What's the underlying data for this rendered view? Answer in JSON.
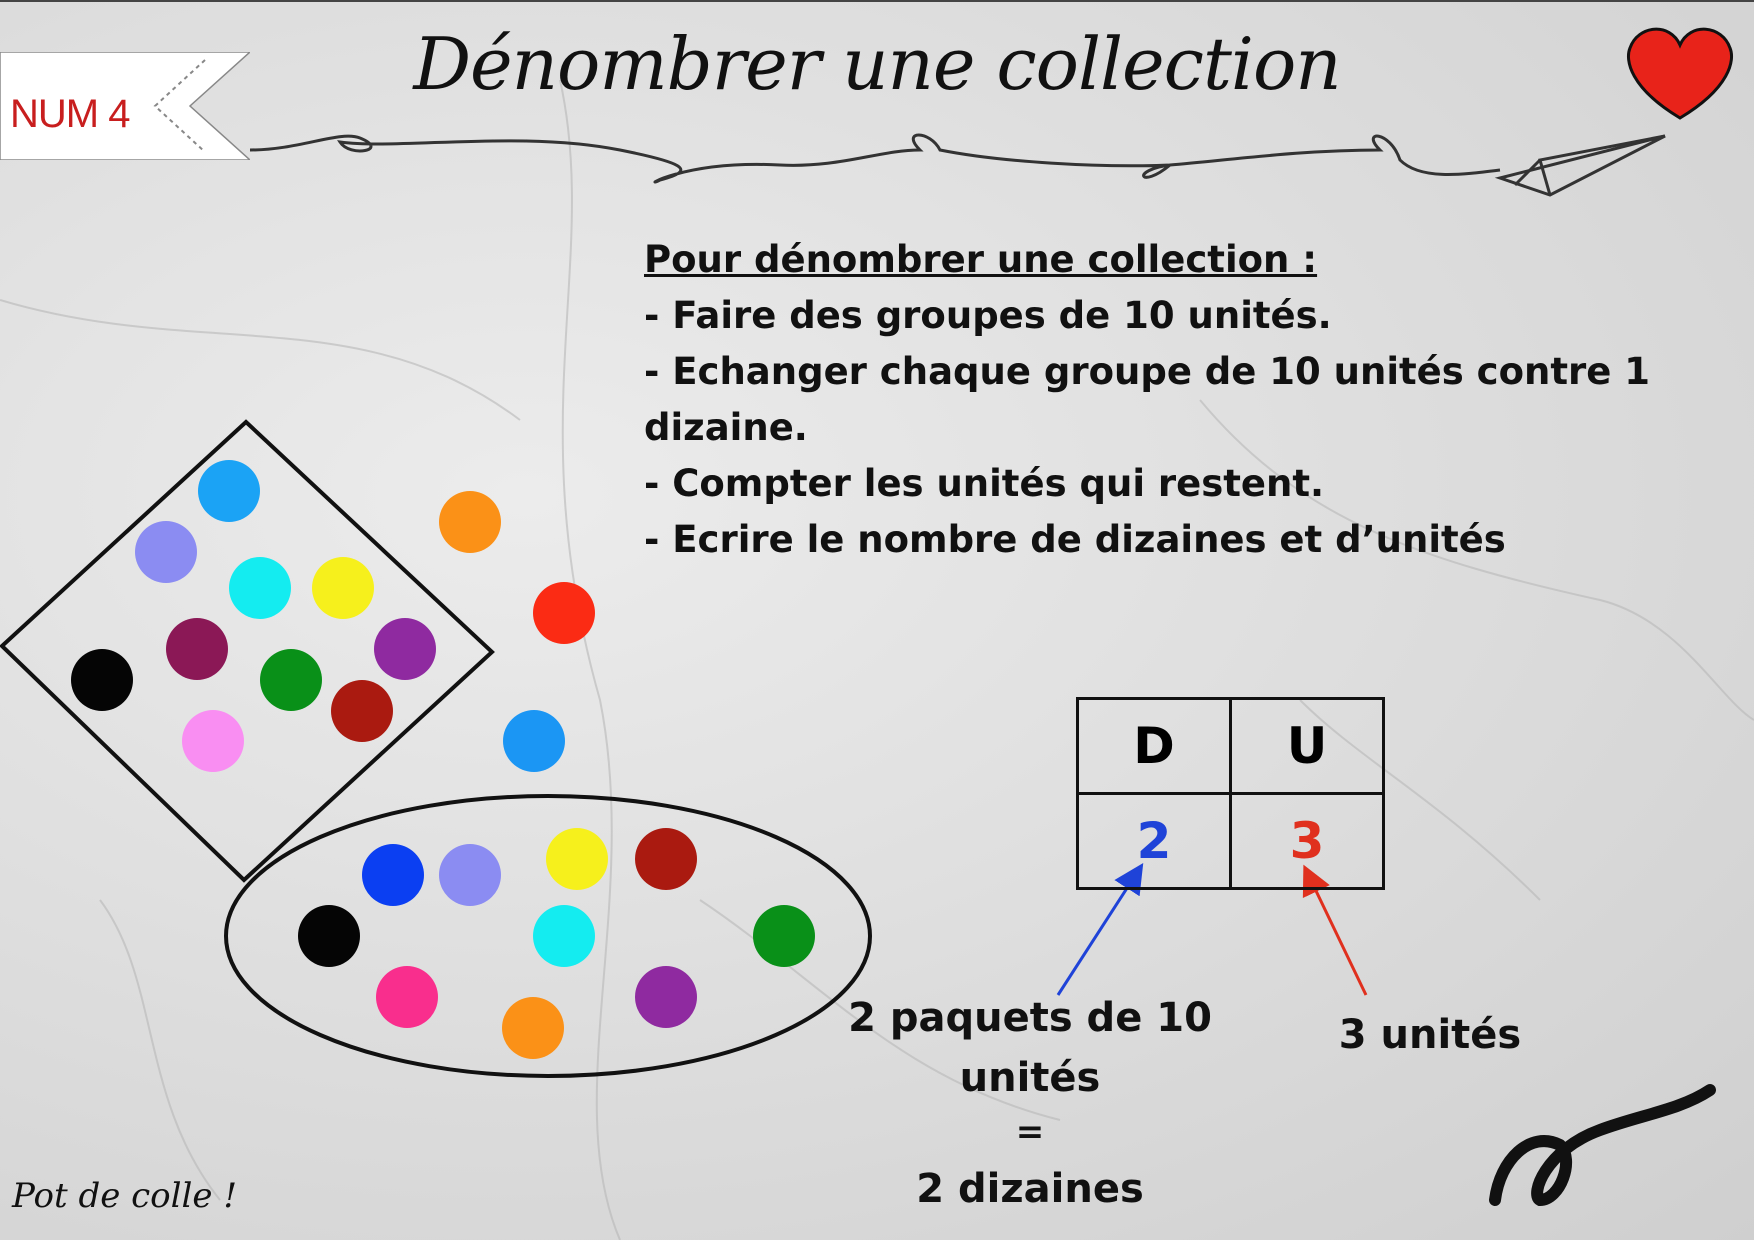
{
  "badge": {
    "label": "NUM 4"
  },
  "title": "Dénombrer une collection",
  "rules": {
    "heading": "Pour dénombrer une collection :",
    "steps": [
      "- Faire des groupes de 10 unités.",
      "- Echanger chaque groupe de 10 unités contre 1 dizaine.",
      "- Compter les unités qui restent.",
      "- Ecrire le nombre de dizaines et d’unités"
    ]
  },
  "table": {
    "headers": [
      "D",
      "U"
    ],
    "values": [
      "2",
      "3"
    ],
    "color_d": "#1f43d8",
    "color_u": "#e0301e"
  },
  "annotations": {
    "tens_line1": "2 paquets de 10",
    "tens_line2": "unités",
    "equals": "=",
    "tens_result": "2 dizaines",
    "units": "3 unités"
  },
  "footer": {
    "signature": "Pot de colle !"
  },
  "colors": {
    "heart": "#e8231a",
    "badge_text": "#c81e1e"
  },
  "icons": [
    "heart-icon",
    "paper-plane-icon",
    "swirl-decoration"
  ]
}
